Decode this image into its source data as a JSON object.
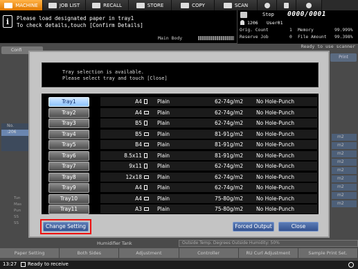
{
  "topbar": {
    "tabs": [
      {
        "label": "MACHINE",
        "active": true,
        "icon": "machine-icon"
      },
      {
        "label": "JOB LIST",
        "active": false,
        "icon": "joblist-icon"
      },
      {
        "label": "RECALL",
        "active": false,
        "icon": "recall-icon"
      },
      {
        "label": "STORE",
        "active": false,
        "icon": "store-icon"
      },
      {
        "label": "COPY",
        "active": false,
        "icon": "copy-icon"
      },
      {
        "label": "SCAN",
        "active": false,
        "icon": "scan-icon"
      }
    ],
    "small_icons": [
      "brightness-icon",
      "volume-icon",
      "help-icon"
    ]
  },
  "message": {
    "line1": "Please load designated paper in tray1",
    "line2": "To check details,touch [Confirm Details]",
    "main_body_label": "Main Body"
  },
  "status": {
    "state": "Stop",
    "count": "0000/0001",
    "job_id": "1206",
    "user": "User01",
    "orig_count_label": "Orig. Count",
    "orig_count_value": "1",
    "memory_label": "Memory",
    "memory_value": "99.999%",
    "reserve_job_label": "Reserve Job",
    "reserve_job_value": "0",
    "file_amount_label": "File Amount",
    "file_amount_value": "99.398%"
  },
  "background": {
    "confirm_label": "Confi",
    "ready_text": "Ready to use scanner",
    "print_label": "Print",
    "list_header": "No.",
    "list_selected": ":206",
    "right_items": [
      "m2",
      "m2",
      "m2",
      "m2",
      "m2",
      "m2",
      "m2",
      "m2",
      "m2"
    ],
    "tray_icons": [
      "Tun",
      "Mas",
      "Pun",
      "SS",
      "SS"
    ],
    "humidifier_label": "Humidifier Tank",
    "outside_text": "Outside Temp.       Degrees   Outside Humidity: 50%",
    "bottom_tabs": [
      "Paper Setting",
      "Both Sides",
      "Adjustment",
      "Controller",
      "RU Curl Adjustment",
      "Sample Print Set."
    ]
  },
  "footer": {
    "time": "13:27",
    "message": "Ready to receive"
  },
  "dialog": {
    "msg_line1": "Tray selection is available.",
    "msg_line2": "Please select tray and touch [Close]",
    "trays": [
      {
        "name": "Tray1",
        "selected": true,
        "size": "A4",
        "orient": "portrait",
        "type": "Plain",
        "weight": "62-74g/m2",
        "punch": "No Hole-Punch"
      },
      {
        "name": "Tray2",
        "selected": false,
        "size": "A4",
        "orient": "landscape",
        "type": "Plain",
        "weight": "62-74g/m2",
        "punch": "No Hole-Punch"
      },
      {
        "name": "Tray3",
        "selected": false,
        "size": "B5",
        "orient": "portrait",
        "type": "Plain",
        "weight": "62-74g/m2",
        "punch": "No Hole-Punch"
      },
      {
        "name": "Tray4",
        "selected": false,
        "size": "B5",
        "orient": "landscape",
        "type": "Plain",
        "weight": "81-91g/m2",
        "punch": "No Hole-Punch"
      },
      {
        "name": "Tray5",
        "selected": false,
        "size": "B4",
        "orient": "landscape",
        "type": "Plain",
        "weight": "81-91g/m2",
        "punch": "No Hole-Punch"
      },
      {
        "name": "Tray6",
        "selected": false,
        "size": "8.5x11",
        "orient": "portrait",
        "type": "Plain",
        "weight": "81-91g/m2",
        "punch": "No Hole-Punch"
      },
      {
        "name": "Tray7",
        "selected": false,
        "size": "9x11",
        "orient": "portrait",
        "type": "Plain",
        "weight": "62-74g/m2",
        "punch": "No Hole-Punch"
      },
      {
        "name": "Tray8",
        "selected": false,
        "size": "12x18",
        "orient": "landscape",
        "type": "Plain",
        "weight": "62-74g/m2",
        "punch": "No Hole-Punch"
      },
      {
        "name": "Tray9",
        "selected": false,
        "size": "A4",
        "orient": "portrait",
        "type": "Plain",
        "weight": "62-74g/m2",
        "punch": "No Hole-Punch"
      },
      {
        "name": "Tray10",
        "selected": false,
        "size": "A4",
        "orient": "landscape",
        "type": "Plain",
        "weight": "75-80g/m2",
        "punch": "No Hole-Punch"
      },
      {
        "name": "Tray11",
        "selected": false,
        "size": "A3",
        "orient": "landscape",
        "type": "Plain",
        "weight": "75-80g/m2",
        "punch": "No Hole-Punch"
      }
    ],
    "change_setting_label": "Change Setting",
    "forced_output_label": "Forced Output",
    "close_label": "Close"
  }
}
